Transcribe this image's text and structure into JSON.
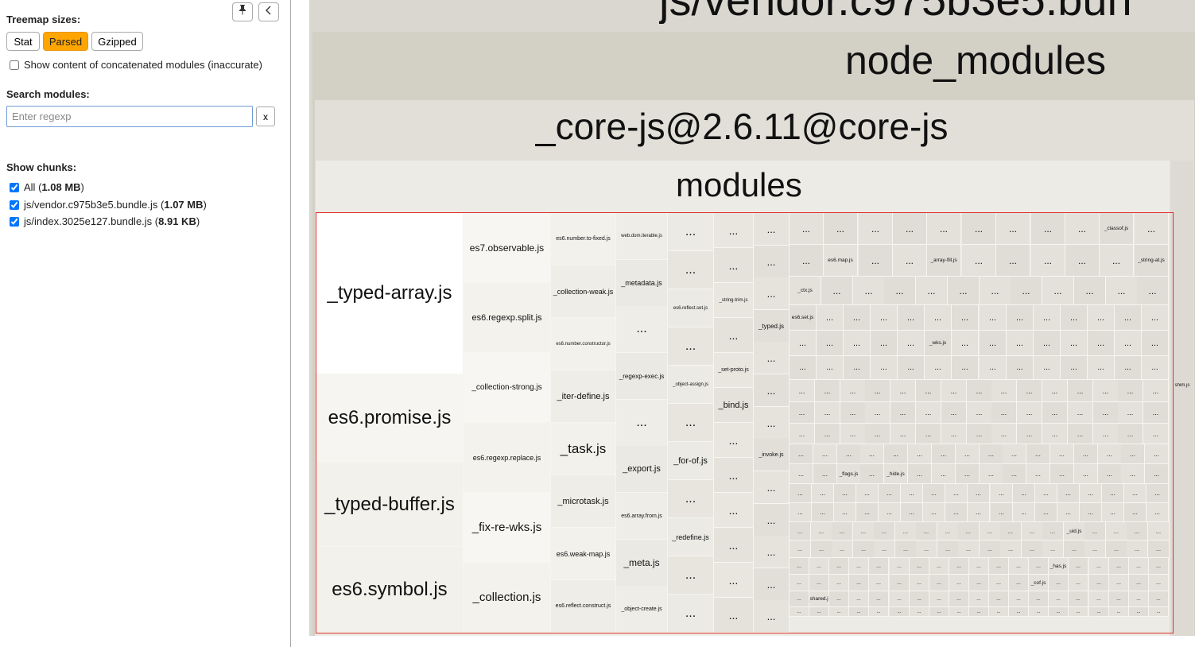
{
  "sidebar": {
    "treemap_sizes_label": "Treemap sizes:",
    "size_buttons": [
      "Stat",
      "Parsed",
      "Gzipped"
    ],
    "active_size": "Parsed",
    "concat_label": "Show content of concatenated modules (inaccurate)",
    "search_label": "Search modules:",
    "search_placeholder": "Enter regexp",
    "search_clear": "x",
    "show_chunks_label": "Show chunks:",
    "chunks": [
      {
        "name": "All",
        "size": "1.08 MB",
        "checked": true
      },
      {
        "name": "js/vendor.c975b3e5.bundle.js",
        "size": "1.07 MB",
        "checked": true
      },
      {
        "name": "js/index.3025e127.bundle.js",
        "size": "8.91 KB",
        "checked": true
      }
    ],
    "pin_icon": "pin-icon",
    "collapse_icon": "chevron-left-icon"
  },
  "treemap": {
    "bundle_label": "js/vendor.c975b3e5.bun",
    "node_modules_label": "node_modules",
    "package_label": "_core-js@2.6.11@core-js",
    "modules_label": "modules",
    "large_modules": [
      "_typed-array.js",
      "es6.promise.js",
      "_typed-buffer.js",
      "es6.symbol.js"
    ],
    "column2": [
      "es7.observable.js",
      "es6.regexp.split.js",
      "_collection-strong.js",
      "es6.regexp.replace.js",
      "_fix-re-wks.js",
      "_collection.js"
    ],
    "column3": [
      "es6.number.to-fixed.js",
      "_collection-weak.js",
      "es6.number.constructor.js",
      "_iter-define.js",
      "_task.js",
      "_microtask.js",
      "es6.weak-map.js",
      "es6.reflect.construct.js"
    ],
    "column4": [
      "web.dom.iterable.js",
      "_metadata.js",
      "...",
      "_regexp-exec.js",
      "...",
      "_export.js",
      "es6.array.from.js",
      "_meta.js",
      "_object-create.js"
    ],
    "column5": [
      "...",
      "...",
      "es6.reflect.set.js",
      "...",
      "_object-assign.js",
      "...",
      "_for-of.js",
      "...",
      "_redefine.js",
      "...",
      "..."
    ],
    "column6": [
      "...",
      "...",
      "_string-trim.js",
      "...",
      "_set-proto.js",
      "_bind.js",
      "...",
      "...",
      "...",
      "...",
      "...",
      "..."
    ],
    "column7": [
      "...",
      "...",
      "...",
      "_typed.js",
      "...",
      "...",
      "...",
      "_invoke.js",
      "...",
      "...",
      "...",
      "...",
      "..."
    ],
    "small_labels": [
      "_classof.js",
      "es6.map.js",
      "_array-fill.js",
      "_string-at.js",
      "_ctx.js",
      "es6.set.js",
      "_wks.js",
      "_flags.js",
      "_hide.js",
      "_uid.js",
      "_has.js",
      "_cof.js",
      "_shared.js",
      "shim.js"
    ],
    "ellipsis": "..."
  }
}
